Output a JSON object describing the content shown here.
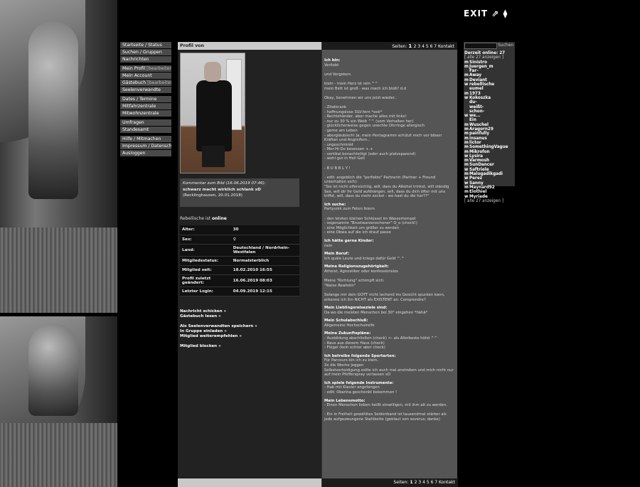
{
  "exit": {
    "label": "EXIT ⇗ ⧫"
  },
  "nav": {
    "groups": [
      [
        "Startseite / Status",
        "Suchen / Gruppen",
        "Nachrichten"
      ],
      [
        "Mein Profil",
        "Mein Account",
        "Gästebuch",
        "Seelenverwandte"
      ],
      [
        "Dates / Termine",
        "Mitfahrzentrale",
        "Mitwohnzentrale"
      ],
      [
        "Umfragen",
        "Standesamt"
      ],
      [
        "Hilfe / Mitmachen",
        "Impressum / Datenschutzhinweise",
        "Ausloggen"
      ]
    ],
    "edit_label": "[bearbeiten]"
  },
  "profile": {
    "header": "Profil von",
    "comment_heading": "Kommentar zum Bild (16.06.2019 07:46):",
    "comment_text": "schwarz macht wirklich schlank xD",
    "comment_place": "(Recklinghausen, 20.01.2018)",
    "online_prefix": "Rebellische ist ",
    "online_status": "online",
    "details": [
      {
        "label": "Alter:",
        "value": "30"
      },
      {
        "label": "Sex:",
        "value": "♀"
      },
      {
        "label": "Land:",
        "value": "Deutschland / Nordrhein-Westfalen"
      },
      {
        "label": "Mitgliedsstatus:",
        "value": "Normalsterblich"
      },
      {
        "label": "Mitglied seit:",
        "value": "18.02.2010 16:55"
      },
      {
        "label": "Profil zuletzt geändert:",
        "value": "16.06.2019 08:03"
      },
      {
        "label": "Letzter Login:",
        "value": "04.09.2019 12:15"
      }
    ],
    "actions": {
      "send_message": "Nachricht schicken »",
      "read_guestbook": "Gästebuch lesen »",
      "save_soulmate": "Als Seelenverwandten speichern »",
      "invite_group": "In Gruppe einladen »",
      "recommend": "Mitglied weiterempfehlen »",
      "block": "Mitglied blocken »"
    }
  },
  "pager": {
    "prefix": "Seiten:",
    "pages": [
      "1",
      "2",
      "3",
      "4",
      "5",
      "6",
      "7"
    ],
    "contact": "Kontakt"
  },
  "about": {
    "sections": [
      {
        "h": "Ich bin:",
        "lines": [
          "Verliebt",
          "",
          "und Vergeben.",
          "",
          "klein - mein Herz ist rein ^^",
          "mein Bett ist groß - was mach ich bloß? d.d",
          "",
          "Okay, benehmen wir uns jetzt wieder..",
          "",
          "- Zitatkrank",
          "- hoffnungslose DLV-fern *eek*",
          "- Rechtshänder, aber mache alles mit links!",
          "- nur zu 30 % ein Weib ^^ (vom Verhalten her)",
          "- glücklicherweise gegen unechte Ohrringe allergisch",
          "- gerne am Leben",
          "- abergläubisch! Ja, mein Pentagramm schützt mich vor bösen Kräften und Angreifern..",
          "- ungeschminkt",
          "- Mer-Hi-Do besessen +.+",
          "- vertikal benachteiligt (oder auch platzsparend)",
          "- wohl gut in Hell Gell",
          "",
          "- B U B B L Y !",
          "",
          "- edit: angeblich die \"perfekte\" Partnerin (Partner + Freund unterhalten sich):",
          "\"Sie ist nicht eifersüchtig, will, dass du Alkohol trinkst, will ständig Sex, will dir Ihr Geld aufdrängen, will, dass du dich öfter mit uns triffst, will, dass du mehr zockst - wo hast du die her??\""
        ]
      },
      {
        "h": "Ich suche:",
        "lines": [
          "Partyvolk zum Feten feiern",
          "",
          "- den letzten kleinen Schlüssel im Wassertempel",
          "- sogenannte \"Brustwarzenschoner\" O_o (check!)",
          "- eine Möglichkeit um größer zu werden",
          "- eine Obwa auf die ich drauf passe"
        ]
      },
      {
        "h": "Ich hätte gerne Kinder:",
        "lines": [
          "nein"
        ]
      },
      {
        "h": "Mein Beruf:",
        "lines": [
          "Ich quäle Leute und kriege dafür Geld ^.^"
        ]
      },
      {
        "h": "Meine Religionszugehörigkeit:",
        "lines": [
          "Atheist, Agnostiker oder konfessionslos",
          "",
          "Meine \"Richtung\" schimpft sich:",
          "\"Naive Realistin\"",
          "",
          "Solange mir dein GOTT nicht lachend ins Gesicht spucken kann, erkenne ich ihn NICHT als EXISTENT an. Comprendre?"
        ]
      },
      {
        "h": "Mein Lieblingsreiseziele sind:",
        "lines": [
          "Da wo die meisten Menschen bei 30° eingehen *hähä*"
        ]
      },
      {
        "h": "Mein Schulabschluß:",
        "lines": [
          "Allgemeine Hochschulreife"
        ]
      },
      {
        "h": "Meine Zukunftspläne:",
        "lines": [
          "- Ausbildung abschließen (check) <- als Allerbeste höhö ^^",
          "- Raus aus diesem Haus (check)",
          "- Flügel (kein echter aber check)"
        ]
      },
      {
        "h": "Ich betreibe folgende Sportarten:",
        "lines": [
          "Für Parcours bin ich zu klein..",
          "3x die Woche Joggen",
          "Selbstverteidigung sollte ich auch mal anstreben und mich nicht nur auf mein Pfefferspray verlassen xD"
        ]
      },
      {
        "h": "Ich spiele folgende Instrumente:",
        "lines": [
          "- Hab mit Klavier angefangen",
          "- edit: Okarina geschenkt bekommen !"
        ]
      },
      {
        "h": "Mein Lebensmotto:",
        "lines": [
          "- Einen Menschen lieben heißt einwilligen, mit ihm alt zu werden.",
          "",
          "- Ein in Freiheit gewähltes Seidenband ist tausendmal stärker als jede aufgezwungene Stahlkette (geklaut von severus; danke)"
        ]
      }
    ]
  },
  "sidebar": {
    "search_button": "Suchen",
    "online_title": "Derzeit online: 27",
    "show_all": "[ alle 27 anzeigen ]",
    "users": [
      {
        "g": "m",
        "n": "Sinistro",
        "b": false
      },
      {
        "g": "m",
        "n": "Juergen_m",
        "b": false
      },
      {
        "g": "m",
        "n": "Far-Away",
        "b": false
      },
      {
        "g": "m",
        "n": "Deviant",
        "b": true
      },
      {
        "g": "w",
        "n": "rebellische",
        "b": false
      },
      {
        "g": "m",
        "n": "eumel 1973",
        "b": true
      },
      {
        "g": "w",
        "n": "Kokoszka",
        "b": false
      },
      {
        "g": "w",
        "n": "du-weißt-schon-we...",
        "b": false
      },
      {
        "g": "m",
        "n": "Ein Wuschel",
        "b": true
      },
      {
        "g": "m",
        "n": "Aragorn29",
        "b": false
      },
      {
        "g": "m",
        "n": "painfully",
        "b": true
      },
      {
        "g": "m",
        "n": "insanus",
        "b": true
      },
      {
        "g": "m",
        "n": "lictor",
        "b": false
      },
      {
        "g": "m",
        "n": "SomethingVague",
        "b": true
      },
      {
        "g": "m",
        "n": "Mikrofon",
        "b": true
      },
      {
        "g": "w",
        "n": "Lysira",
        "b": true
      },
      {
        "g": "m",
        "n": "Varmosh",
        "b": true
      },
      {
        "g": "m",
        "n": "SunDancer",
        "b": false
      },
      {
        "g": "w",
        "n": "Saftriele",
        "b": true
      },
      {
        "g": "m",
        "n": "Malogadikgadi",
        "b": false
      },
      {
        "g": "w",
        "n": "Perez",
        "b": true
      },
      {
        "g": "w",
        "n": "Sanny",
        "b": true
      },
      {
        "g": "m",
        "n": "Maynard92",
        "b": false
      },
      {
        "g": "m",
        "n": "Elothiel",
        "b": false
      },
      {
        "g": "w",
        "n": "Myriade",
        "b": false
      }
    ]
  }
}
